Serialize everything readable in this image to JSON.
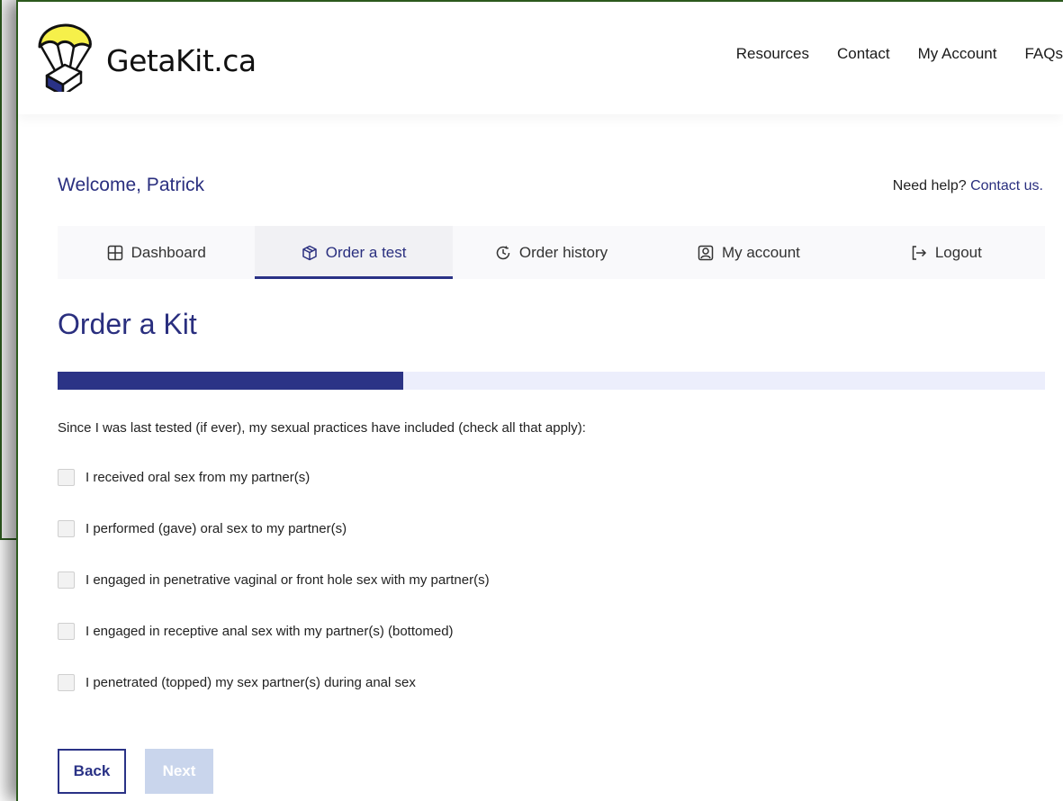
{
  "brand": {
    "name": "GetaKit.ca",
    "primary_color": "#2a3286",
    "parachute_color": "#f6f04a"
  },
  "nav": {
    "items": [
      "Resources",
      "Contact",
      "My Account",
      "FAQs"
    ]
  },
  "welcome": {
    "text": "Welcome, Patrick"
  },
  "help": {
    "prefix": "Need help?",
    "link": "Contact us."
  },
  "tabs": [
    {
      "label": "Dashboard",
      "icon": "grid-icon"
    },
    {
      "label": "Order a test",
      "icon": "box-icon",
      "active": true
    },
    {
      "label": "Order history",
      "icon": "clock-icon"
    },
    {
      "label": "My account",
      "icon": "user-icon"
    },
    {
      "label": "Logout",
      "icon": "logout-icon"
    }
  ],
  "main": {
    "title": "Order a Kit",
    "progress_fraction": 0.35,
    "question": "Since I was last tested (if ever), my sexual practices have included (check all that apply):",
    "options": [
      {
        "label": "I received oral sex from my partner(s)",
        "checked": false
      },
      {
        "label": "I performed (gave) oral sex to my partner(s)",
        "checked": false
      },
      {
        "label": "I engaged in penetrative vaginal or front hole sex with my partner(s)",
        "checked": false
      },
      {
        "label": "I engaged in receptive anal sex with my partner(s) (bottomed)",
        "checked": false
      },
      {
        "label": "I penetrated (topped) my sex partner(s) during anal sex",
        "checked": false
      }
    ]
  },
  "buttons": {
    "back": "Back",
    "next": "Next"
  }
}
